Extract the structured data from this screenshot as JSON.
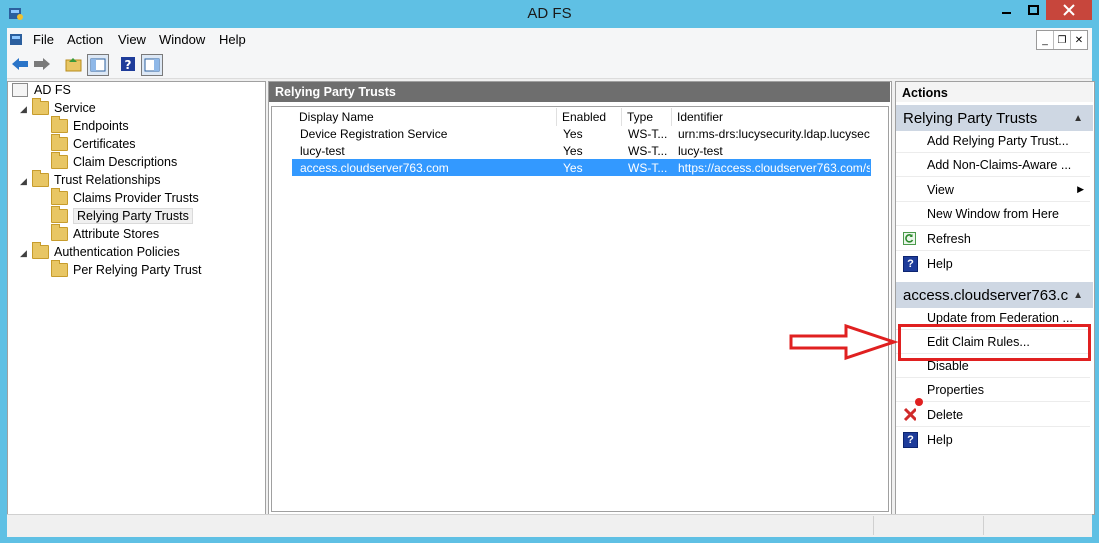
{
  "window": {
    "title": "AD FS"
  },
  "menubar": {
    "items": [
      "File",
      "Action",
      "View",
      "Window",
      "Help"
    ]
  },
  "tree": {
    "root": "AD FS",
    "items": [
      {
        "label": "Service",
        "level": 1
      },
      {
        "label": "Endpoints",
        "level": 2
      },
      {
        "label": "Certificates",
        "level": 2
      },
      {
        "label": "Claim Descriptions",
        "level": 2
      },
      {
        "label": "Trust Relationships",
        "level": 1
      },
      {
        "label": "Claims Provider Trusts",
        "level": 2
      },
      {
        "label": "Relying Party Trusts",
        "level": 2,
        "selected": true
      },
      {
        "label": "Attribute Stores",
        "level": 2
      },
      {
        "label": "Authentication Policies",
        "level": 1
      },
      {
        "label": "Per Relying Party Trust",
        "level": 2
      }
    ]
  },
  "center": {
    "title": "Relying Party Trusts",
    "columns": [
      "Display Name",
      "Enabled",
      "Type",
      "Identifier"
    ],
    "rows": [
      {
        "name": "Device Registration Service",
        "enabled": "Yes",
        "type": "WS-T...",
        "identifier": "urn:ms-drs:lucysecurity.ldap.lucysecuri..."
      },
      {
        "name": "lucy-test",
        "enabled": "Yes",
        "type": "WS-T...",
        "identifier": "lucy-test"
      },
      {
        "name": "access.cloudserver763.com",
        "enabled": "Yes",
        "type": "WS-T...",
        "identifier": "https://access.cloudserver763.com/s..."
      }
    ]
  },
  "actions": {
    "header": "Actions",
    "section1": {
      "title": "Relying Party Trusts",
      "items": [
        "Add Relying Party Trust...",
        "Add Non-Claims-Aware ...",
        "View",
        "New Window from Here",
        "Refresh",
        "Help"
      ]
    },
    "section2": {
      "title": "access.cloudserver763.c...",
      "items": [
        "Update from Federation ...",
        "Edit Claim Rules...",
        "Disable",
        "Properties",
        "Delete",
        "Help"
      ]
    }
  },
  "colors": {
    "selection": "#3399ff",
    "annotation": "#e02020",
    "section_bg": "#ced7e3"
  }
}
